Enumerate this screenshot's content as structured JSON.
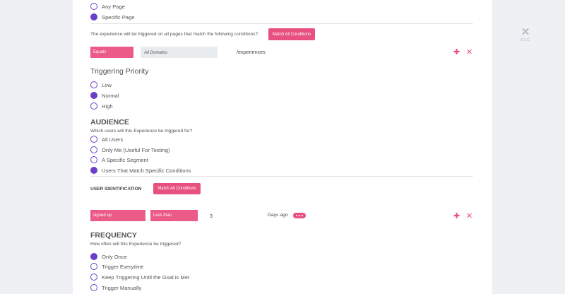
{
  "page_rules": {
    "options": [
      {
        "label": "Any Page",
        "checked": false
      },
      {
        "label": "Specific Page",
        "checked": true
      }
    ],
    "conditions_text": "The experience will be triggered on all pages that match the following conditions?",
    "match_button": "Match All Conditions",
    "condition": {
      "operator": "Equals",
      "domain": "All Domains",
      "path": "/experiences"
    }
  },
  "priority": {
    "title": "Triggering Priority",
    "options": [
      {
        "label": "Low",
        "checked": false
      },
      {
        "label": "Normal",
        "checked": true
      },
      {
        "label": "High",
        "checked": false
      }
    ]
  },
  "audience": {
    "title": "AUDIENCE",
    "question": "Which users will this Experience be triggered for?",
    "options": [
      {
        "label": "All Users",
        "checked": false
      },
      {
        "label": "Only Me (Useful For Testing)",
        "checked": false
      },
      {
        "label": "A Specific Segment",
        "checked": false
      },
      {
        "label": "Users That Match Specific Conditions",
        "checked": true
      }
    ],
    "user_identification_label": "USER IDENTIFICATION",
    "match_button": "Match All Conditions",
    "condition": {
      "event": "signed up",
      "comparator": "Less than",
      "value": "3",
      "unit": "Days ago"
    }
  },
  "frequency": {
    "title": "FREQUENCY",
    "question": "How often will this Experience be triggered?",
    "options": [
      {
        "label": "Only Once",
        "checked": true
      },
      {
        "label": "Trigger Everytime",
        "checked": false
      },
      {
        "label": "Keep Triggering Until the Goal is Met",
        "checked": false
      },
      {
        "label": "Trigger Manually",
        "checked": false
      }
    ]
  },
  "modal": {
    "close_label": "ESC"
  },
  "colors": {
    "accent_pink": "#e8517f",
    "radio_purple": "#6a3fc7",
    "backdrop": "#eef0f3"
  }
}
